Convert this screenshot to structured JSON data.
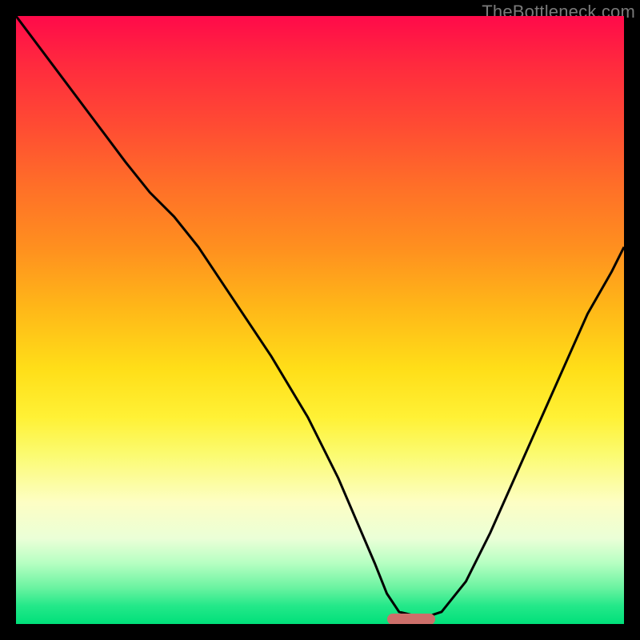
{
  "watermark": "TheBottleneck.com",
  "colors": {
    "background": "#000000",
    "curve_stroke": "#000000",
    "marker": "#cc6f6a",
    "watermark_text": "#7a7a7a"
  },
  "chart_data": {
    "type": "line",
    "title": "",
    "xlabel": "",
    "ylabel": "",
    "xlim": [
      0,
      100
    ],
    "ylim": [
      0,
      100
    ],
    "grid": false,
    "legend": false,
    "series": [
      {
        "name": "bottleneck-curve",
        "x": [
          0,
          6,
          12,
          18,
          22,
          26,
          30,
          36,
          42,
          48,
          53,
          56,
          59,
          61,
          63,
          67,
          70,
          74,
          78,
          82,
          86,
          90,
          94,
          98,
          100
        ],
        "values": [
          100,
          92,
          84,
          76,
          71,
          67,
          62,
          53,
          44,
          34,
          24,
          17,
          10,
          5,
          2,
          1,
          2,
          7,
          15,
          24,
          33,
          42,
          51,
          58,
          62
        ]
      }
    ],
    "marker": {
      "x_start": 61,
      "x_end": 69,
      "y": 0.8
    },
    "background_gradient_stops": [
      {
        "pos": 0,
        "color": "#ff0a4a"
      },
      {
        "pos": 8,
        "color": "#ff2a3e"
      },
      {
        "pos": 18,
        "color": "#ff4b33"
      },
      {
        "pos": 28,
        "color": "#ff6f28"
      },
      {
        "pos": 38,
        "color": "#ff8f1f"
      },
      {
        "pos": 48,
        "color": "#ffb718"
      },
      {
        "pos": 58,
        "color": "#ffde18"
      },
      {
        "pos": 66,
        "color": "#fff135"
      },
      {
        "pos": 72,
        "color": "#fbfb6f"
      },
      {
        "pos": 80,
        "color": "#fdfec4"
      },
      {
        "pos": 86,
        "color": "#eaffd7"
      },
      {
        "pos": 90,
        "color": "#b6ffc2"
      },
      {
        "pos": 94,
        "color": "#6bf3a1"
      },
      {
        "pos": 97,
        "color": "#24e889"
      },
      {
        "pos": 100,
        "color": "#00e07a"
      }
    ]
  }
}
